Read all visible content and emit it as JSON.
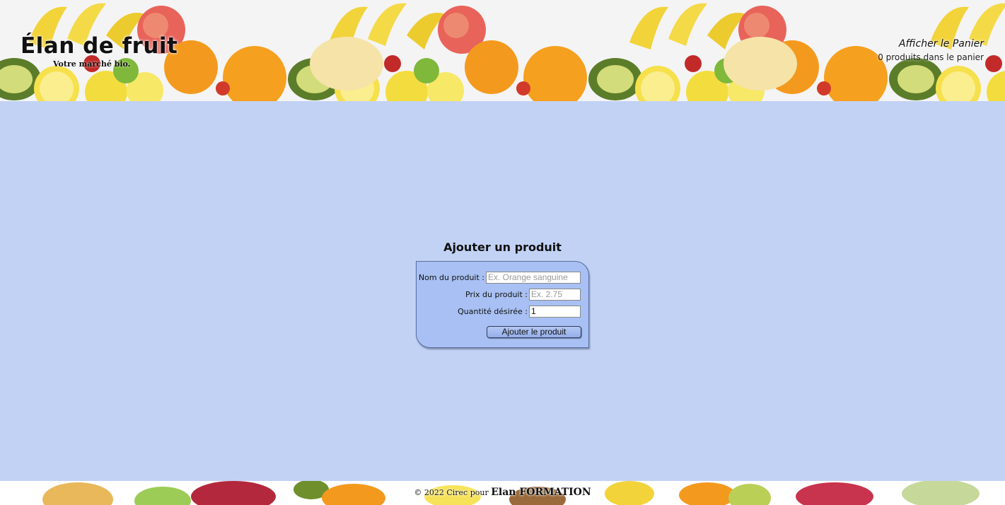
{
  "header": {
    "brand_title": "Élan de fruit",
    "brand_tagline": "Votre marché bio.",
    "cart_link": "Afficher le Panier",
    "cart_count": "0 produits dans le panier"
  },
  "form": {
    "title": "Ajouter un produit",
    "name_label": "Nom du produit :",
    "name_placeholder": "Ex. Orange sanguine",
    "price_label": "Prix du produit :",
    "price_placeholder": "Ex. 2.75",
    "qty_label": "Quantité désirée :",
    "qty_value": "1",
    "submit_label": "Ajouter le produit"
  },
  "footer": {
    "copyright_prefix": "© 2022 Cirec pour",
    "copyright_org": "Elan FORMATION"
  },
  "colors": {
    "main_background": "#c2d2f5",
    "form_panel": "#a8c0f3",
    "header_background": "#f4f4f4"
  },
  "icons": [
    "fruit-banner-image",
    "fruit-footer-image"
  ]
}
